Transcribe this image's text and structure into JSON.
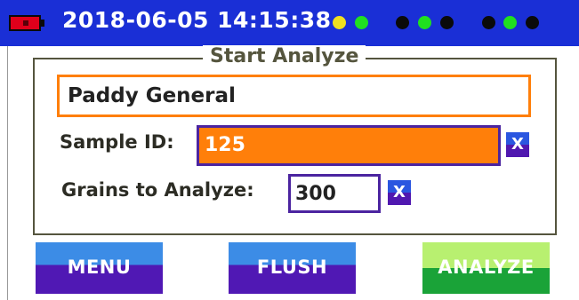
{
  "status_bar": {
    "datetime": "2018-06-05 14:15:38",
    "battery_color": "#e0001b",
    "indicators": [
      {
        "color": "#f0e020"
      },
      {
        "color": "#20e020"
      },
      {
        "color": "#0a0a0a"
      },
      {
        "color": "#20e020"
      },
      {
        "color": "#0a0a0a"
      },
      {
        "color": "#0a0a0a"
      },
      {
        "color": "#20e020"
      },
      {
        "color": "#0a0a0a"
      }
    ]
  },
  "panel": {
    "title": "Start Analyze",
    "profile": "Paddy General",
    "sample_id_label": "Sample ID:",
    "sample_id_value": "125",
    "grains_label": "Grains to Analyze:",
    "grains_value": "300",
    "clear_label": "X"
  },
  "buttons": {
    "menu": "MENU",
    "flush": "FLUSH",
    "analyze": "ANALYZE"
  }
}
